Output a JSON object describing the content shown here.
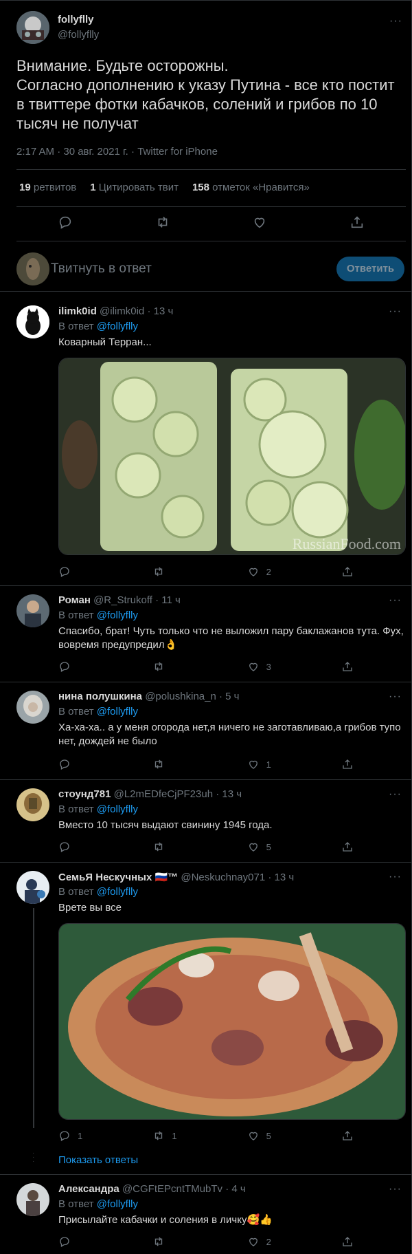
{
  "main": {
    "name": "follyflly",
    "handle": "@follyflly",
    "text": "Внимание. Будьте осторожны.\nСогласно дополнению к указу Путина - все кто постит в твиттере фотки кабачков, солений и грибов по 10 тысяч не получат",
    "time": "2:17 AM · 30 авг. 2021 г. · ",
    "source": "Twitter for iPhone",
    "stats": {
      "retweets_count": "19",
      "retweets_label": "ретвитов",
      "quotes_count": "1",
      "quotes_label": "Цитировать твит",
      "likes_count": "158",
      "likes_label": "отметок «Нравится»"
    }
  },
  "compose": {
    "placeholder": "Твитнуть в ответ",
    "button": "Ответить"
  },
  "in_reply_prefix": "В ответ ",
  "in_reply_handle": "@follyflly",
  "replies": [
    {
      "name": "ilimk0id",
      "handle": "@ilimk0id",
      "time": " · 13 ч",
      "text": "Коварный Терран...",
      "likes": "2",
      "retweets": "",
      "comments": "",
      "has_media": true,
      "media_desc": "Pickled zucchini in jars",
      "watermark": "RussianFood.com"
    },
    {
      "name": "Роман",
      "handle": "@R_Strukoff",
      "time": " · 11 ч",
      "text": "Спасибо, брат! Чуть только что не выложил пару баклажанов тута. Фух, вовремя предупредил👌",
      "likes": "3",
      "retweets": "",
      "comments": ""
    },
    {
      "name": "нина полушкина",
      "handle": "@polushkina_n",
      "time": " · 5 ч",
      "text": "Ха-ха-ха.. а у меня огорода нет,я ничего не заготавливаю,а грибов тупо нет, дождей не было",
      "likes": "1",
      "retweets": "",
      "comments": ""
    },
    {
      "name": "стоунд781",
      "handle": "@L2mEDfeCjPF23uh",
      "time": " · 13 ч",
      "text": "Вместо 10 тысяч выдают свинину 1945 года.",
      "likes": "5",
      "retweets": "",
      "comments": ""
    },
    {
      "name": "СемьЯ Нескучных 🇷🇺™",
      "handle": "@Neskuchnay071",
      "time": " · 13 ч",
      "text": "Врете вы все",
      "likes": "5",
      "retweets": "1",
      "comments": "1",
      "has_media": true,
      "media_desc": "Plate of plov with meat"
    },
    {
      "name": "Александра",
      "handle": "@CGFtEPcntTMubTv",
      "time": " · 4 ч",
      "text": "Присылайте кабачки и соления в личку🥰👍",
      "likes": "2",
      "retweets": "",
      "comments": ""
    }
  ],
  "show_replies": "Показать ответы",
  "icons": [
    "reply-icon",
    "retweet-icon",
    "like-icon",
    "share-icon",
    "more-icon"
  ],
  "colors": {
    "background": "#000000",
    "accent": "#1d9bf0",
    "muted": "#6e767d",
    "border": "#2f3336"
  }
}
